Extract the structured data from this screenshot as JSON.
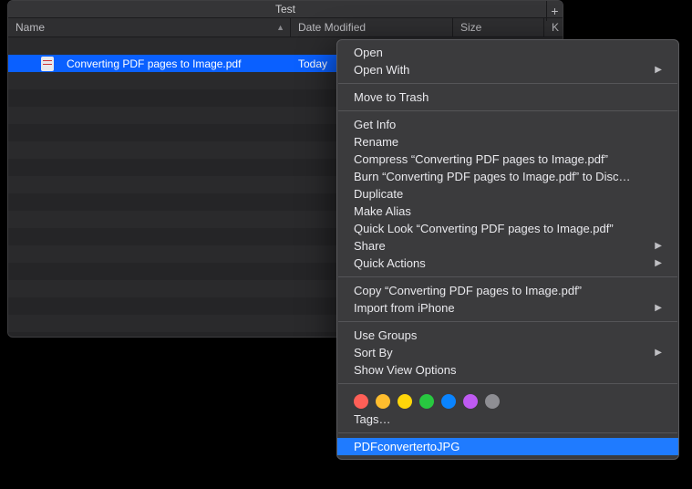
{
  "window": {
    "title": "Test"
  },
  "columns": {
    "name": "Name",
    "date": "Date Modified",
    "size": "Size",
    "extra": "K"
  },
  "file": {
    "name": "Converting PDF pages to Image.pdf",
    "date": "Today"
  },
  "ctx": {
    "open": "Open",
    "openWith": "Open With",
    "trash": "Move to Trash",
    "getInfo": "Get Info",
    "rename": "Rename",
    "compress": "Compress “Converting PDF pages to Image.pdf”",
    "burn": "Burn “Converting PDF pages to Image.pdf” to Disc…",
    "duplicate": "Duplicate",
    "makeAlias": "Make Alias",
    "quickLook": "Quick Look “Converting PDF pages to Image.pdf”",
    "share": "Share",
    "quickAct": "Quick Actions",
    "copy": "Copy “Converting PDF pages to Image.pdf”",
    "importIph": "Import from iPhone",
    "useGroups": "Use Groups",
    "sortBy": "Sort By",
    "viewOpts": "Show View Options",
    "tagsLabel": "Tags…",
    "service": "PDFconvertertoJPG"
  },
  "tagColors": [
    "#ff5f57",
    "#ffbd2e",
    "#ffd60a",
    "#28c840",
    "#0a84ff",
    "#bf5af2",
    "#8e8e93"
  ]
}
